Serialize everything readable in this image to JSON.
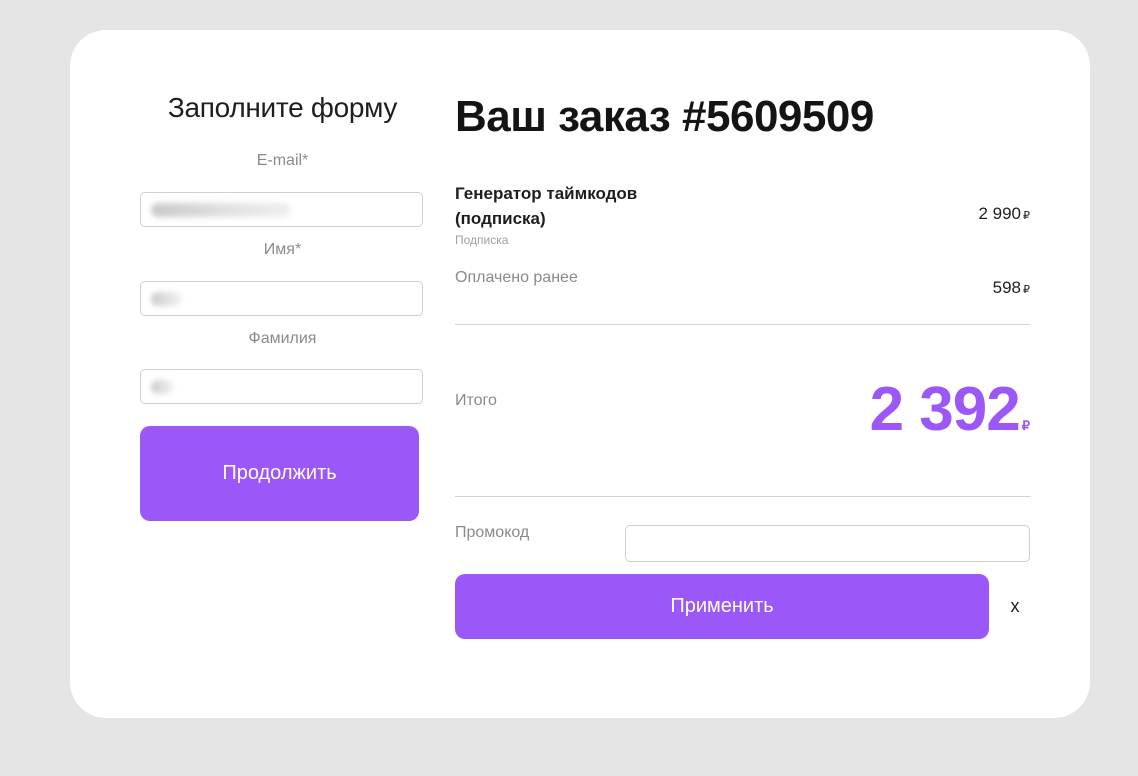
{
  "form": {
    "title": "Заполните форму",
    "email": {
      "label": "E-mail*",
      "value": ""
    },
    "first_name": {
      "label": "Имя*",
      "value": ""
    },
    "last_name": {
      "label": "Фамилия",
      "value": ""
    },
    "continue_label": "Продолжить"
  },
  "order": {
    "title": "Ваш заказ #5609509",
    "item": {
      "name": "Генератор таймкодов (подписка)",
      "type": "Подписка",
      "price": "2 990",
      "currency": "₽"
    },
    "paid_before": {
      "label": "Оплачено ранее",
      "amount": "598",
      "currency": "₽"
    },
    "total": {
      "label": "Итого",
      "amount": "2 392",
      "currency": "₽"
    },
    "promo": {
      "label": "Промокод",
      "value": "",
      "apply_label": "Применить",
      "clear_label": "x"
    }
  },
  "colors": {
    "accent": "#9b57f7",
    "background": "#e5e5e5",
    "card": "#ffffff"
  }
}
